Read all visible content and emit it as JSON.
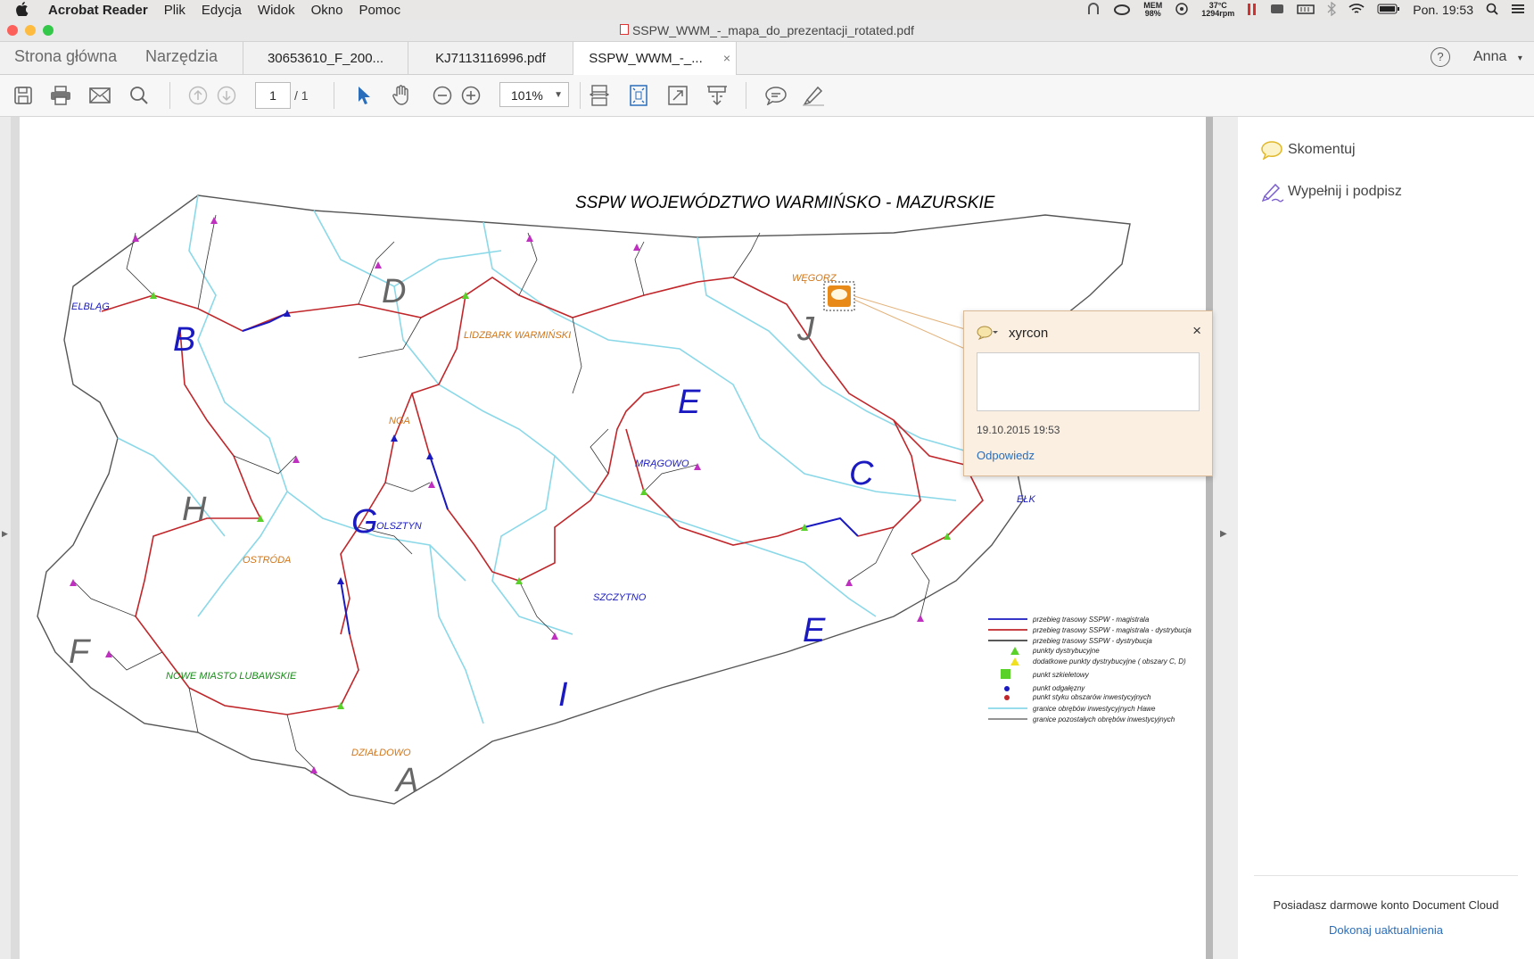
{
  "menubar": {
    "app": "Acrobat Reader",
    "menus": [
      "Plik",
      "Edycja",
      "Widok",
      "Okno",
      "Pomoc"
    ],
    "status": {
      "mem_label": "MEM",
      "mem_value": "98%",
      "temp": "37°C",
      "rpm": "1294rpm",
      "clock": "Pon. 19:53"
    }
  },
  "window": {
    "title": "SSPW_WWM_-_mapa_do_prezentacji_rotated.pdf"
  },
  "tabs": {
    "home": "Strona główna",
    "tools": "Narzędzia",
    "docs": [
      "30653610_F_200...",
      "KJ7113116996.pdf",
      "SSPW_WWM_-_..."
    ],
    "close": "×",
    "help": "?",
    "user": "Anna"
  },
  "toolbar": {
    "page_current": "1",
    "page_total": "/ 1",
    "zoom": "101%"
  },
  "map": {
    "title": "SSPW   WOJEWÓDZTWO  WARMIŃSKO - MAZURSKIE",
    "regions": [
      "D",
      "B",
      "H",
      "F",
      "G",
      "A",
      "I",
      "E",
      "J",
      "C",
      "E"
    ],
    "cities": [
      "ELBLĄG",
      "OLSZTYN",
      "OSTRÓDA",
      "NOWE MIASTO LUBAWSKIE",
      "DZIAŁDOWO",
      "SZCZYTNO",
      "MRĄGOWO",
      "EŁK",
      "WĘGORZ",
      "LIDZBARK WARMIŃSKI",
      "NGA"
    ],
    "legend": [
      "przebieg trasowy SSPW - magistrala",
      "przebieg trasowy SSPW - magistrala - dystrybucja",
      "przebieg trasowy SSPW - dystrybucja",
      "punkty dystrybucyjne",
      "dodatkowe punkty dystrybucyjne ( obszary C, D)",
      "punkt szkieletowy",
      "punkt odgałęzny",
      "punkt styku obszarów inwestycyjnych",
      "granice obrębów inwestycyjnych Hawe",
      "granice pozostałych obrębów inwestycyjnych"
    ]
  },
  "comment_popup": {
    "author": "xyrcon",
    "date": "19.10.2015  19:53",
    "reply": "Odpowiedz",
    "close": "×"
  },
  "right_panel": {
    "items": [
      "Skomentuj",
      "Wypełnij i podpisz"
    ],
    "footer_text": "Posiadasz darmowe konto Document Cloud",
    "footer_link": "Dokonaj uaktualnienia"
  },
  "colors": {
    "accent": "#2a6ebb",
    "route_red": "#c0262a",
    "route_blue": "#1a1ac0",
    "border_cyan": "#7fd6e6"
  }
}
